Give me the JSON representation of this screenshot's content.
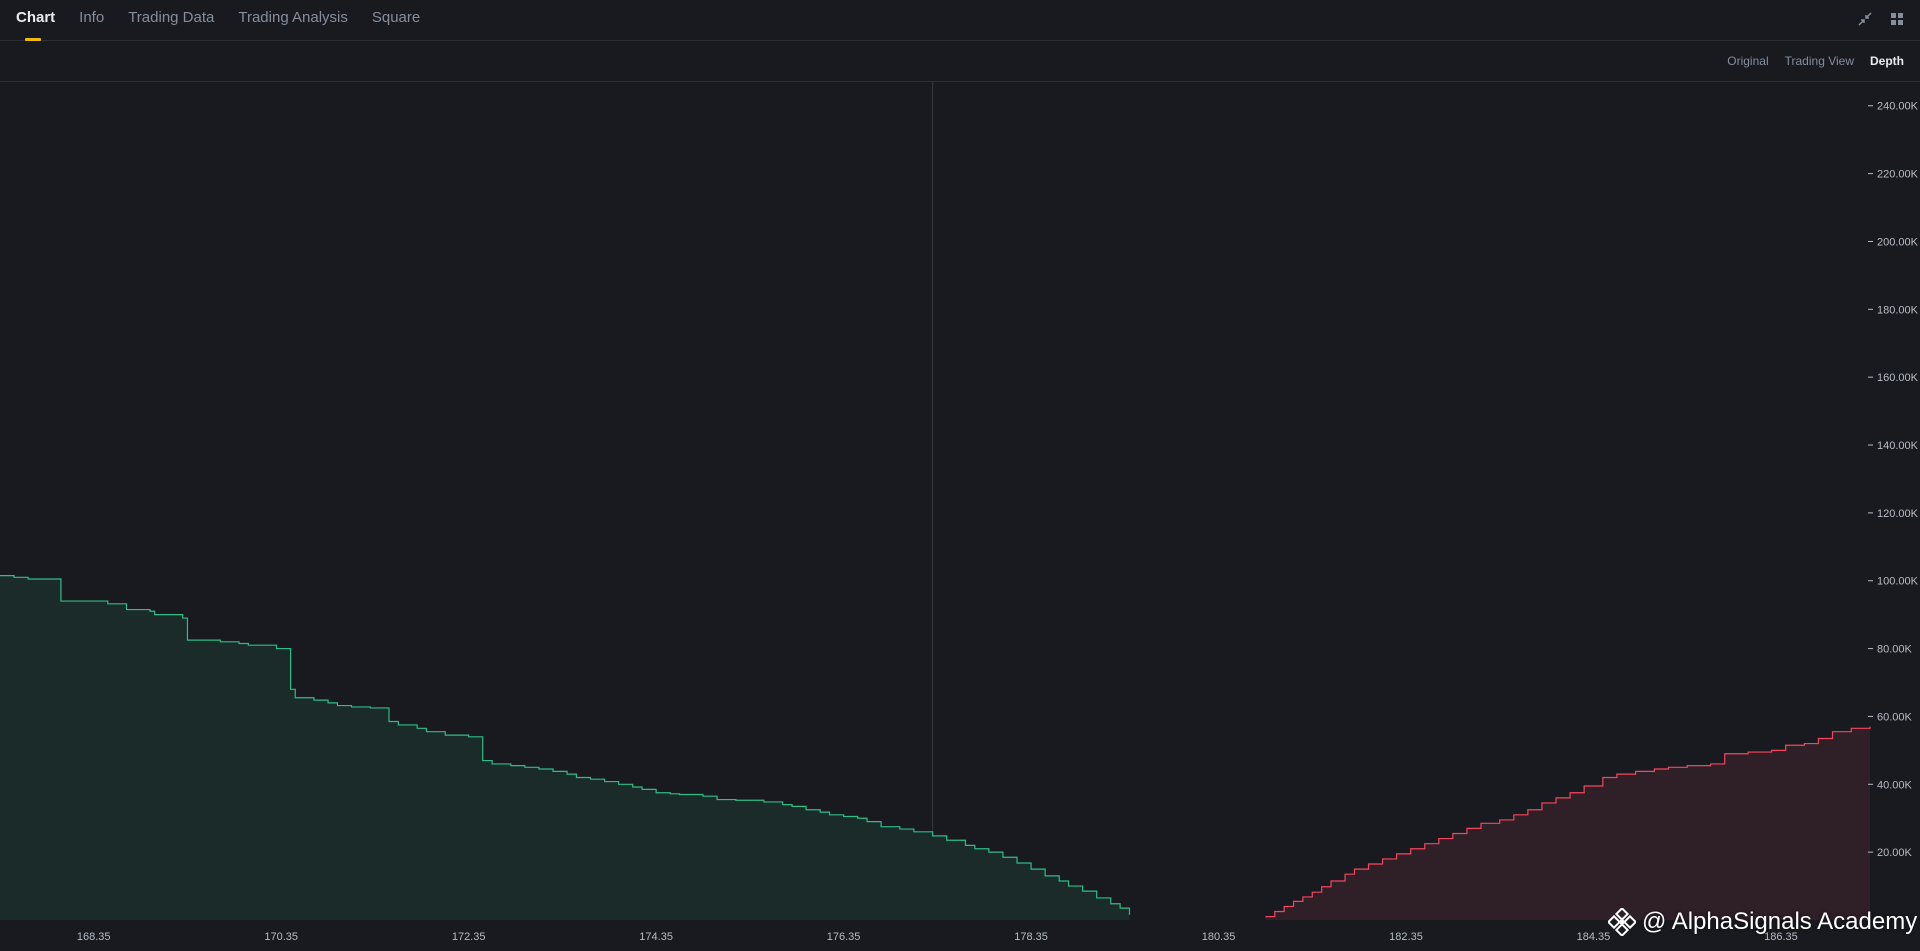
{
  "tabs": [
    {
      "label": "Chart",
      "active": true
    },
    {
      "label": "Info",
      "active": false
    },
    {
      "label": "Trading Data",
      "active": false
    },
    {
      "label": "Trading Analysis",
      "active": false
    },
    {
      "label": "Square",
      "active": false
    }
  ],
  "top_icons": [
    "collapse-arrows-icon",
    "grid-layout-icon"
  ],
  "views": [
    {
      "label": "Original",
      "active": false
    },
    {
      "label": "Trading View",
      "active": false
    },
    {
      "label": "Depth",
      "active": true
    }
  ],
  "watermark": {
    "text": "@ AlphaSignals Academy",
    "icon": "binance-logo-icon"
  },
  "colors": {
    "background": "#181a20",
    "bid_line": "#2ebd85",
    "bid_fill": "#1b2b2a",
    "ask_line": "#f6465d",
    "ask_fill": "#2f1f27",
    "accent": "#f0b90b"
  },
  "chart_data": {
    "type": "area",
    "title": "",
    "xlabel": "",
    "ylabel": "",
    "x_ticks": [
      "168.35",
      "170.35",
      "172.35",
      "174.35",
      "176.35",
      "178.35",
      "180.35",
      "182.35",
      "184.35",
      "186.35"
    ],
    "y_ticks": [
      "20.00K",
      "40.00K",
      "60.00K",
      "80.00K",
      "100.00K",
      "120.00K",
      "140.00K",
      "160.00K",
      "180.00K",
      "200.00K",
      "220.00K",
      "240.00K"
    ],
    "xlim": [
      167.35,
      187.3
    ],
    "ylim": [
      0,
      247000
    ],
    "mid_price": 177.3,
    "grid": false,
    "series": [
      {
        "side": "bids",
        "points": [
          [
            167.35,
            101500
          ],
          [
            167.5,
            101000
          ],
          [
            167.65,
            100500
          ],
          [
            168.0,
            94000
          ],
          [
            168.5,
            93200
          ],
          [
            168.7,
            91500
          ],
          [
            168.95,
            91000
          ],
          [
            169.0,
            90000
          ],
          [
            169.3,
            89000
          ],
          [
            169.35,
            82500
          ],
          [
            169.7,
            82000
          ],
          [
            169.9,
            81500
          ],
          [
            170.0,
            81000
          ],
          [
            170.3,
            80000
          ],
          [
            170.45,
            68000
          ],
          [
            170.5,
            65500
          ],
          [
            170.7,
            64800
          ],
          [
            170.85,
            64000
          ],
          [
            170.95,
            63200
          ],
          [
            171.1,
            62800
          ],
          [
            171.3,
            62500
          ],
          [
            171.5,
            58500
          ],
          [
            171.6,
            57500
          ],
          [
            171.8,
            56500
          ],
          [
            171.9,
            55500
          ],
          [
            172.1,
            54500
          ],
          [
            172.35,
            54000
          ],
          [
            172.5,
            47000
          ],
          [
            172.6,
            46000
          ],
          [
            172.8,
            45500
          ],
          [
            172.95,
            45000
          ],
          [
            173.1,
            44500
          ],
          [
            173.25,
            43800
          ],
          [
            173.4,
            43000
          ],
          [
            173.5,
            42000
          ],
          [
            173.65,
            41500
          ],
          [
            173.8,
            40800
          ],
          [
            173.95,
            40000
          ],
          [
            174.1,
            39200
          ],
          [
            174.2,
            38500
          ],
          [
            174.35,
            37500
          ],
          [
            174.5,
            37200
          ],
          [
            174.6,
            37000
          ],
          [
            174.85,
            36500
          ],
          [
            175.0,
            35500
          ],
          [
            175.2,
            35300
          ],
          [
            175.5,
            34800
          ],
          [
            175.7,
            34000
          ],
          [
            175.8,
            33500
          ],
          [
            175.95,
            32500
          ],
          [
            176.1,
            31800
          ],
          [
            176.2,
            31000
          ],
          [
            176.35,
            30500
          ],
          [
            176.5,
            30000
          ],
          [
            176.6,
            29000
          ],
          [
            176.75,
            27500
          ],
          [
            176.95,
            26800
          ],
          [
            177.1,
            26000
          ],
          [
            177.3,
            24800
          ],
          [
            177.45,
            23500
          ],
          [
            177.65,
            22000
          ],
          [
            177.75,
            21000
          ],
          [
            177.9,
            20000
          ],
          [
            178.05,
            18500
          ],
          [
            178.2,
            16800
          ],
          [
            178.35,
            15000
          ],
          [
            178.5,
            13000
          ],
          [
            178.65,
            11500
          ],
          [
            178.75,
            10000
          ],
          [
            178.9,
            8500
          ],
          [
            179.05,
            6500
          ],
          [
            179.2,
            4800
          ],
          [
            179.3,
            3500
          ],
          [
            179.4,
            1500
          ]
        ]
      },
      {
        "side": "asks",
        "points": [
          [
            180.85,
            1000
          ],
          [
            180.95,
            2500
          ],
          [
            181.05,
            4000
          ],
          [
            181.15,
            5500
          ],
          [
            181.25,
            6800
          ],
          [
            181.35,
            8200
          ],
          [
            181.45,
            9800
          ],
          [
            181.55,
            11500
          ],
          [
            181.7,
            13500
          ],
          [
            181.8,
            15000
          ],
          [
            181.95,
            16500
          ],
          [
            182.1,
            18000
          ],
          [
            182.25,
            19500
          ],
          [
            182.4,
            21000
          ],
          [
            182.55,
            22500
          ],
          [
            182.7,
            24000
          ],
          [
            182.85,
            25500
          ],
          [
            183.0,
            27000
          ],
          [
            183.15,
            28500
          ],
          [
            183.35,
            29500
          ],
          [
            183.5,
            31000
          ],
          [
            183.65,
            32500
          ],
          [
            183.8,
            34500
          ],
          [
            183.95,
            36000
          ],
          [
            184.1,
            37500
          ],
          [
            184.25,
            39500
          ],
          [
            184.45,
            42000
          ],
          [
            184.6,
            43000
          ],
          [
            184.8,
            43800
          ],
          [
            185.0,
            44500
          ],
          [
            185.15,
            45000
          ],
          [
            185.35,
            45500
          ],
          [
            185.6,
            46000
          ],
          [
            185.75,
            49000
          ],
          [
            186.0,
            49500
          ],
          [
            186.25,
            50000
          ],
          [
            186.4,
            51500
          ],
          [
            186.6,
            52000
          ],
          [
            186.75,
            53500
          ],
          [
            186.9,
            55500
          ],
          [
            187.1,
            56500
          ],
          [
            187.3,
            57000
          ]
        ]
      }
    ]
  }
}
